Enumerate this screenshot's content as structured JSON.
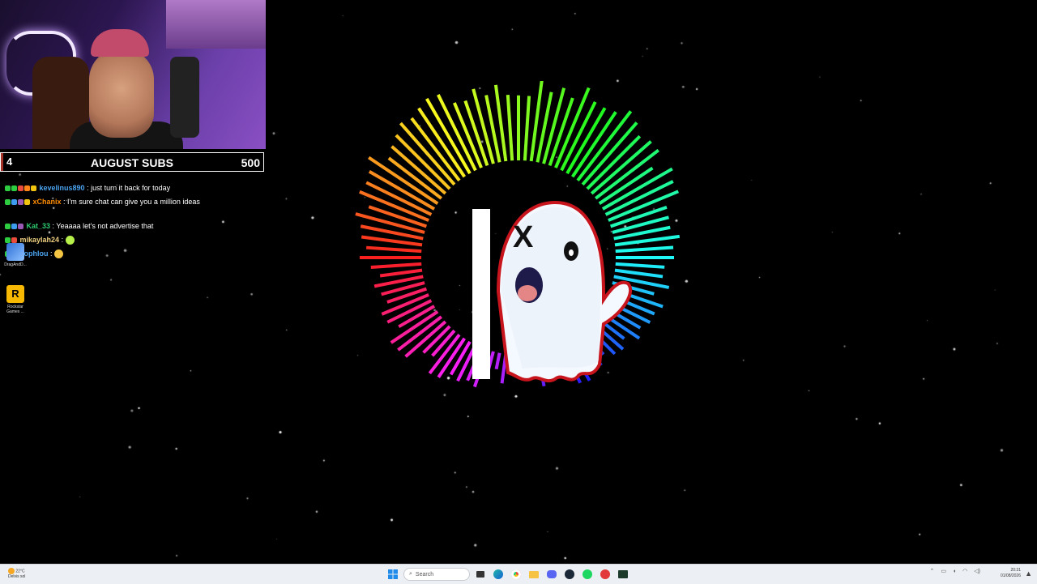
{
  "subs": {
    "title": "AUGUST SUBS",
    "goal": "500",
    "count": "4",
    "progress": 0.008
  },
  "chat": [
    {
      "user": "kevelinus890",
      "user_color": "#4aa3f0",
      "text": "just turn it back for today",
      "badges": [
        "#2ecc40",
        "#2ecc40",
        "#e74c3c",
        "#ff851b",
        "#f1c40f"
      ],
      "emote": null
    },
    {
      "user": "xChanix",
      "user_color": "#ff8c00",
      "text": "I'm sure chat can give you a million ideas",
      "badges": [
        "#2ecc40",
        "#3d9bf0",
        "#9b59b6",
        "#f1c40f"
      ],
      "emote": null
    },
    {
      "user": "Kat_33",
      "user_color": "#2ecc71",
      "text": "Yeaaaa let's not advertise that",
      "badges": [
        "#2ecc40",
        "#3d9bf0",
        "#9b59b6"
      ],
      "emote": null
    },
    {
      "user": "mikaylah24",
      "user_color": "#f0d080",
      "text": "",
      "badges": [
        "#2ecc40",
        "#e74c3c"
      ],
      "emote": "#b7f04a"
    },
    {
      "user": "sophlou",
      "user_color": "#4aa3f0",
      "text": "",
      "badges": [
        "#2ecc40",
        "#f1c40f"
      ],
      "emote": "#f4c542"
    }
  ],
  "desktop": [
    {
      "label": "DragAndD..."
    },
    {
      "label": "Rockstar Games ..."
    }
  ],
  "taskbar": {
    "weather_temp": "22°C",
    "weather_text": "Delvis sol",
    "search_placeholder": "Search",
    "time": "20:31",
    "date": "01/08/2026"
  },
  "colors": {
    "background": "#000000",
    "taskbar": "#eceff3",
    "subs_progress": "#c0392b"
  }
}
